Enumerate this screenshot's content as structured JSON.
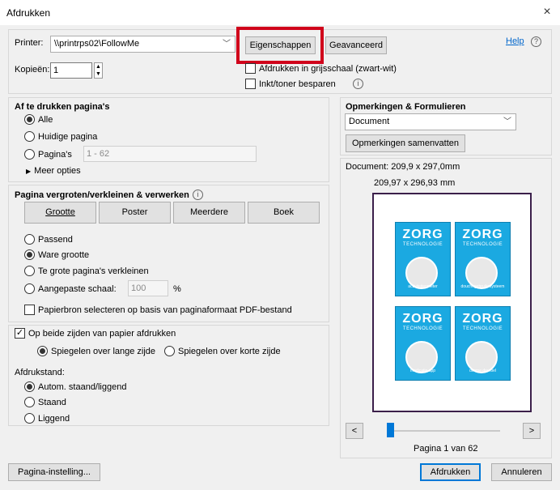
{
  "window": {
    "title": "Afdrukken",
    "close": "×"
  },
  "printer": {
    "label": "Printer:",
    "value": "\\\\printrps02\\FollowMe"
  },
  "buttons": {
    "properties": "Eigenschappen",
    "advanced": "Geavanceerd",
    "help": "Help",
    "help_icon": "?",
    "page_setup": "Pagina-instelling...",
    "print": "Afdrukken",
    "cancel": "Annuleren",
    "summarize": "Opmerkingen samenvatten",
    "prev": "<",
    "next": ">"
  },
  "copies": {
    "label": "Kopieën:",
    "value": "1"
  },
  "options": {
    "grayscale": "Afdrukken in grijsschaal (zwart-wit)",
    "save_ink": "Inkt/toner besparen"
  },
  "pages": {
    "heading": "Af te drukken pagina's",
    "all": "Alle",
    "current": "Huidige pagina",
    "range_label": "Pagina's",
    "range_value": "1 - 62",
    "more": "Meer opties"
  },
  "sizing": {
    "heading": "Pagina vergroten/verkleinen & verwerken",
    "tabs": [
      "Grootte",
      "Poster",
      "Meerdere",
      "Boek"
    ],
    "fit": "Passend",
    "actual": "Ware grootte",
    "shrink": "Te grote pagina's verkleinen",
    "custom_label": "Aangepaste schaal:",
    "custom_value": "100",
    "percent": "%",
    "paper_source": "Papierbron selecteren op basis van paginaformaat PDF-bestand"
  },
  "duplex": {
    "label": "Op beide zijden van papier afdrukken",
    "long": "Spiegelen over lange zijde",
    "short": "Spiegelen over korte zijde"
  },
  "orientation": {
    "heading": "Afdrukstand:",
    "auto": "Autom. staand/liggend",
    "portrait": "Staand",
    "landscape": "Liggend"
  },
  "comments": {
    "heading": "Opmerkingen & Formulieren",
    "value": "Document"
  },
  "preview": {
    "doc_size": "Document: 209,9 x 297,0mm",
    "page_size": "209,97 x 296,93 mm",
    "page_indicator": "Pagina 1 van 62",
    "tile_title": "ZORG",
    "tile_sub": "TECHNOLOGIE",
    "captions": [
      "activiteitenmeter",
      "douchegebruikssysteem",
      "medicatie app",
      "dimme deurbel"
    ]
  },
  "colors": {
    "highlight": "#d0021b",
    "accent": "#0078d7",
    "tile": "#1ba9e1"
  }
}
